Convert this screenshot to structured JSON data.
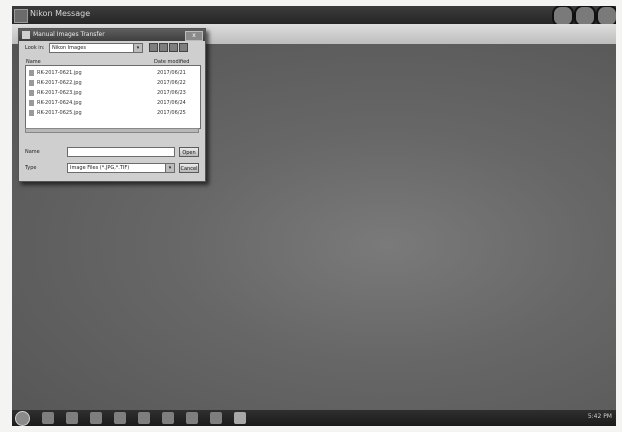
{
  "app": {
    "title": "Nikon Message",
    "menu": [
      "",
      "",
      "",
      "",
      ""
    ]
  },
  "dialog": {
    "title": "Manual Images Transfer",
    "close_label": "x",
    "look_in_label": "Look in:",
    "look_in_value": "Nikon Images",
    "list_name_header": "Name",
    "list_date_header": "Date modified",
    "files": [
      {
        "name": "RK-2017-0621.jpg",
        "date": "2017/06/21"
      },
      {
        "name": "RK-2017-0622.jpg",
        "date": "2017/06/22"
      },
      {
        "name": "RK-2017-0623.jpg",
        "date": "2017/06/23"
      },
      {
        "name": "RK-2017-0624.jpg",
        "date": "2017/06/24"
      },
      {
        "name": "RK-2017-0625.jpg",
        "date": "2017/06/25"
      }
    ],
    "file_name_label": "Name",
    "file_name_value": "",
    "file_type_label": "Type",
    "file_type_value": "Image Files (*.JPG,*.TIF)",
    "open_label": "Open",
    "cancel_label": "Cancel"
  },
  "taskbar": {
    "clock": "5:42 PM"
  },
  "colors": {
    "canvas": "#676767",
    "titlebar": "#2e2e2e",
    "dialog": "#cfcfcf"
  }
}
